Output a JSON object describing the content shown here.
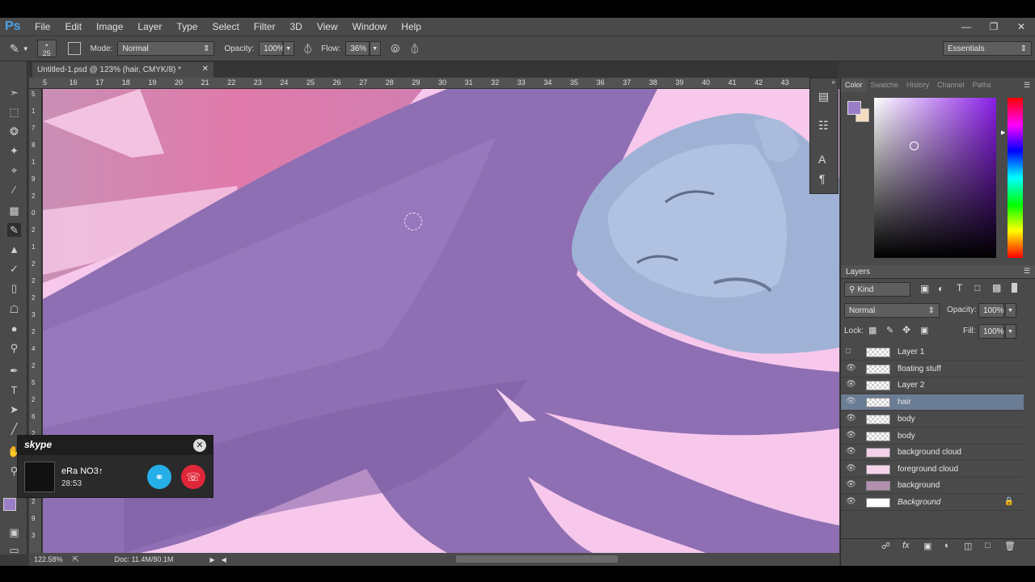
{
  "app": {
    "logo": "Ps"
  },
  "menu": [
    "File",
    "Edit",
    "Image",
    "Layer",
    "Type",
    "Select",
    "Filter",
    "3D",
    "View",
    "Window",
    "Help"
  ],
  "options": {
    "brush_size": "25",
    "mode_label": "Mode:",
    "mode_value": "Normal",
    "opacity_label": "Opacity:",
    "opacity_value": "100%",
    "flow_label": "Flow:",
    "flow_value": "36%",
    "workspace": "Essentials"
  },
  "document": {
    "tab_title": "Untitled-1.psd @ 123% (hair, CMYK/8) *"
  },
  "ruler": {
    "h_ticks": [
      "5",
      "16",
      "17",
      "18",
      "19",
      "20",
      "21",
      "22",
      "23",
      "24",
      "25",
      "26",
      "27",
      "28",
      "29",
      "30",
      "31",
      "32",
      "33",
      "34",
      "35",
      "36",
      "37",
      "38",
      "39",
      "40",
      "41",
      "42",
      "43"
    ],
    "v_ticks": [
      "5",
      "1",
      "7",
      "8",
      "1",
      "9",
      "2",
      "0",
      "2",
      "1",
      "2",
      "2",
      "2",
      "3",
      "2",
      "4",
      "2",
      "5",
      "2",
      "6",
      "2",
      "7",
      "2",
      "8",
      "2",
      "9",
      "3"
    ]
  },
  "status": {
    "zoom": "122.58%",
    "doc": "Doc: 11.4M/80.1M"
  },
  "color_panel": {
    "tabs": [
      "Color",
      "Swatche",
      "History",
      "Channel",
      "Paths"
    ],
    "foreground": "#9b7ec8",
    "background": "#f5dcc0"
  },
  "layers_panel": {
    "title": "Layers",
    "filter": "Kind",
    "blend_mode": "Normal",
    "opacity_label": "Opacity:",
    "opacity_value": "100%",
    "lock_label": "Lock:",
    "fill_label": "Fill:",
    "fill_value": "100%",
    "layers": [
      {
        "name": "Layer 1",
        "visible": false,
        "selected": false
      },
      {
        "name": "floating stuff",
        "visible": true,
        "selected": false
      },
      {
        "name": "Layer 2",
        "visible": true,
        "selected": false
      },
      {
        "name": "hair",
        "visible": true,
        "selected": true
      },
      {
        "name": "body",
        "visible": true,
        "selected": false
      },
      {
        "name": "body",
        "visible": true,
        "selected": false
      },
      {
        "name": "background cloud",
        "visible": true,
        "selected": false
      },
      {
        "name": "foreground cloud",
        "visible": true,
        "selected": false
      },
      {
        "name": "background",
        "visible": true,
        "selected": false
      },
      {
        "name": "Background",
        "visible": true,
        "selected": false
      }
    ]
  },
  "skype": {
    "brand": "skype",
    "contact": "eRa NO3↑",
    "duration": "28:53"
  }
}
